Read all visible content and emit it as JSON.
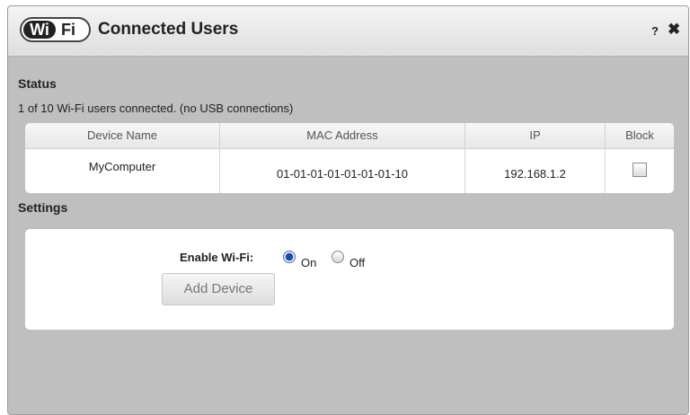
{
  "dialog": {
    "logo": {
      "part1": "Wi",
      "part2": "Fi"
    },
    "title": "Connected Users",
    "help_label": "?",
    "close_label": "✖"
  },
  "status": {
    "heading": "Status",
    "summary": "1 of 10 Wi-Fi users connected. (no USB connections)"
  },
  "table": {
    "headers": [
      "Device Name",
      "MAC Address",
      "IP",
      "Block"
    ],
    "rows": [
      {
        "device": "MyComputer",
        "mac": "01-01-01-01-01-01-01-10",
        "ip": "192.168.1.2",
        "blocked": false
      }
    ]
  },
  "settings": {
    "heading": "Settings",
    "enable_label": "Enable Wi-Fi:",
    "options": [
      "On",
      "Off"
    ],
    "selected": "On",
    "add_device_label": "Add Device"
  }
}
